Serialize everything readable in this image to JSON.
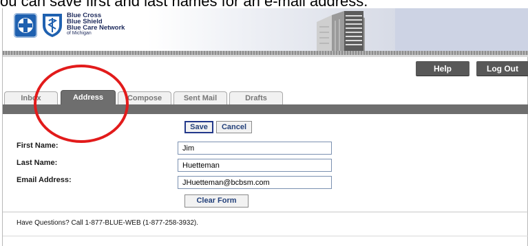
{
  "caption": "ou can save first and last names for an e-mail address.",
  "logo": {
    "line1": "Blue Cross",
    "line2": "Blue Shield",
    "line3": "Blue Care Network",
    "line4": "of Michigan"
  },
  "top_buttons": {
    "help": "Help",
    "logout": "Log Out"
  },
  "tabs": [
    {
      "label": "Inbox"
    },
    {
      "label": "Address"
    },
    {
      "label": "Compose"
    },
    {
      "label": "Sent Mail"
    },
    {
      "label": "Drafts"
    }
  ],
  "form": {
    "save_label": "Save",
    "cancel_label": "Cancel",
    "first_name_label": "First Name:",
    "first_name_value": "Jim",
    "last_name_label": "Last Name:",
    "last_name_value": "Huetteman",
    "email_label": "Email Address:",
    "email_value": "JHuetteman@bcbsm.com",
    "clear_label": "Clear Form"
  },
  "footer": {
    "text": "Have Questions? Call 1-877-BLUE-WEB (1-877-258-3932)."
  },
  "colors": {
    "accent_blue": "#1f61b0",
    "tab_bar_gray": "#6e6e6e",
    "annotation_red": "#e21b1b"
  }
}
